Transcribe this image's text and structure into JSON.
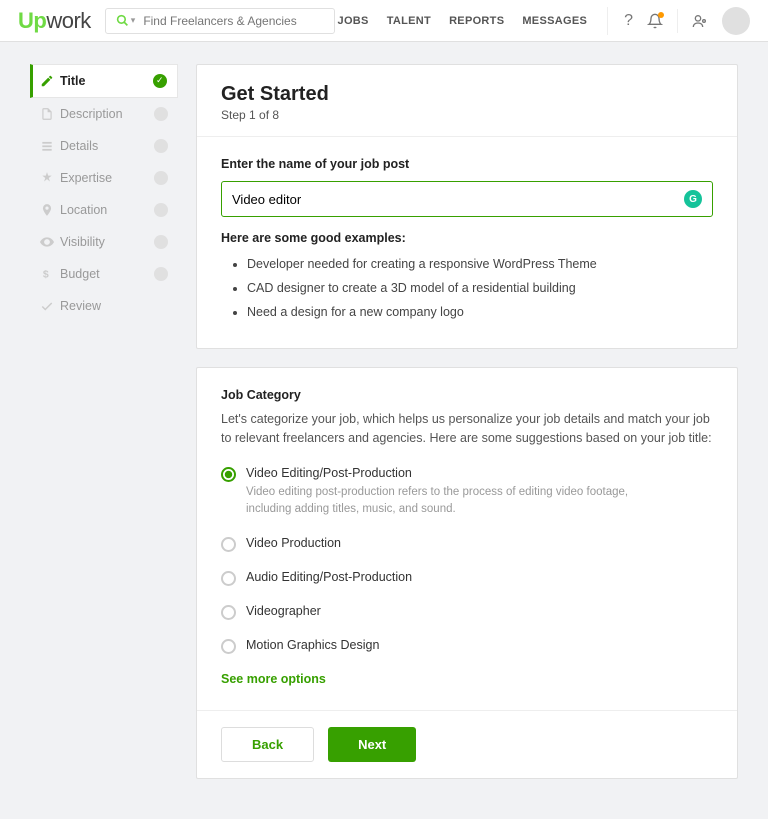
{
  "header": {
    "logo_up": "Up",
    "logo_work": "work",
    "search_placeholder": "Find Freelancers & Agencies",
    "nav": [
      "JOBS",
      "TALENT",
      "REPORTS",
      "MESSAGES"
    ]
  },
  "sidebar": {
    "steps": [
      {
        "label": "Title",
        "active": true
      },
      {
        "label": "Description"
      },
      {
        "label": "Details"
      },
      {
        "label": "Expertise"
      },
      {
        "label": "Location"
      },
      {
        "label": "Visibility"
      },
      {
        "label": "Budget"
      },
      {
        "label": "Review"
      }
    ]
  },
  "main": {
    "title": "Get Started",
    "step_text": "Step 1 of 8",
    "job_title_label": "Enter the name of your job post",
    "job_title_value": "Video editor",
    "examples_heading": "Here are some good examples:",
    "examples": [
      "Developer needed for creating a responsive WordPress Theme",
      "CAD designer to create a 3D model of a residential building",
      "Need a design for a new company logo"
    ]
  },
  "category": {
    "heading": "Job Category",
    "desc": "Let's categorize your job, which helps us personalize your job details and match your job to relevant freelancers and agencies. Here are some suggestions based on your job title:",
    "options": [
      {
        "label": "Video Editing/Post-Production",
        "selected": true,
        "desc": "Video editing post-production refers to the process of editing video footage, including adding titles, music, and sound."
      },
      {
        "label": "Video Production"
      },
      {
        "label": "Audio Editing/Post-Production"
      },
      {
        "label": "Videographer"
      },
      {
        "label": "Motion Graphics Design"
      }
    ],
    "see_more": "See more options"
  },
  "buttons": {
    "back": "Back",
    "next": "Next"
  }
}
